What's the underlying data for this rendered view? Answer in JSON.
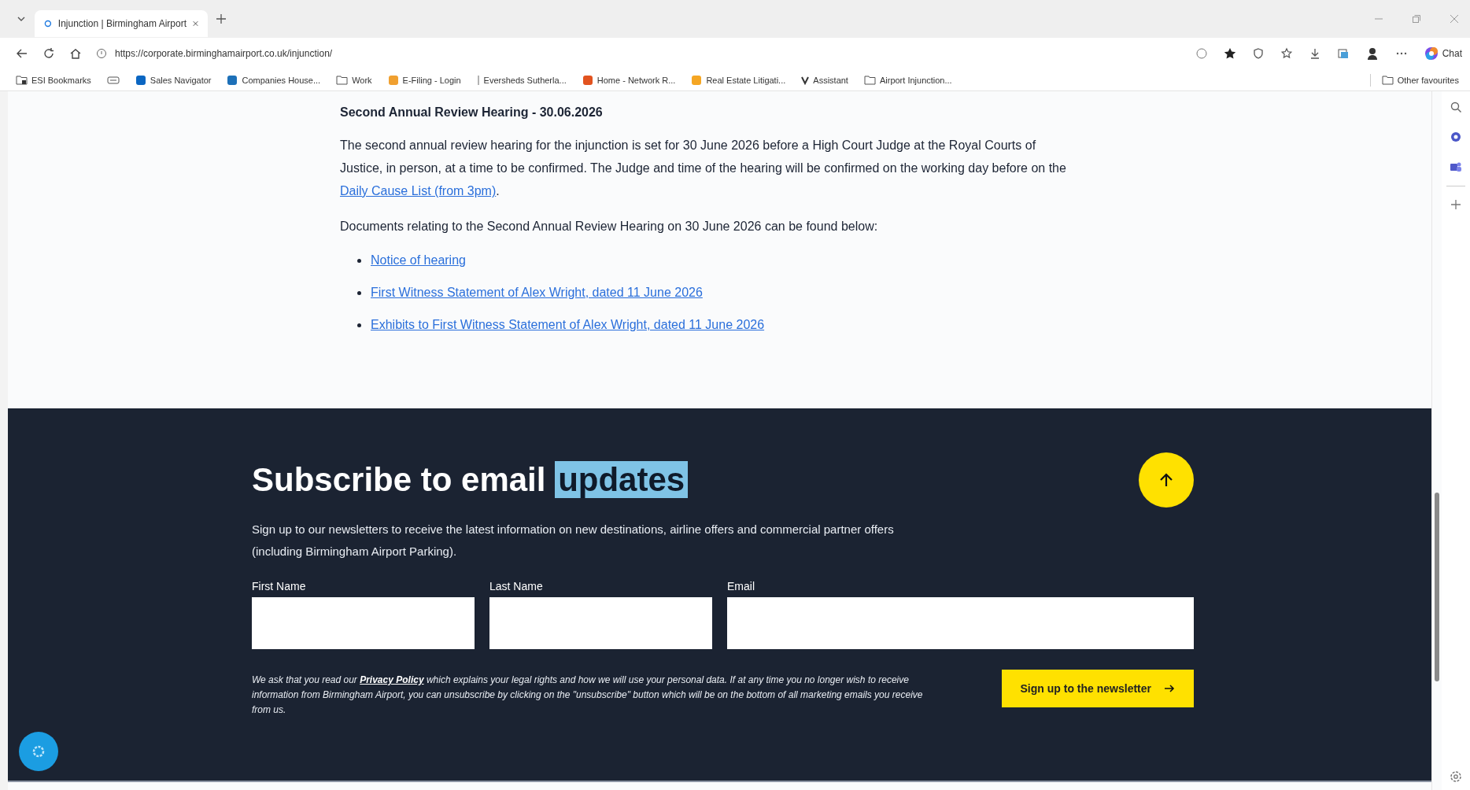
{
  "browser": {
    "tabs": [
      {
        "title": "Injunction | Birmingham Airport",
        "selected": true
      }
    ],
    "url": "https://corporate.birminghamairport.co.uk/injunction/",
    "chat_label": "Chat",
    "bookmarks": [
      {
        "kind": "folder-star",
        "label": "ESI Bookmarks"
      },
      {
        "kind": "card"
      },
      {
        "kind": "site",
        "label": "Sales Navigator",
        "color": "#0a66c2"
      },
      {
        "kind": "site",
        "label": "Companies House...",
        "color": "#1d70b8"
      },
      {
        "kind": "folder",
        "label": "Work"
      },
      {
        "kind": "site",
        "label": "E-Filing - Login",
        "color": "#f0a030"
      },
      {
        "kind": "bar",
        "label": "Eversheds Sutherla..."
      },
      {
        "kind": "site",
        "label": "Home - Network R...",
        "color": "#e2531f"
      },
      {
        "kind": "site",
        "label": "Real Estate Litigati...",
        "color": "#f5a623"
      },
      {
        "kind": "mark",
        "label": "Assistant"
      },
      {
        "kind": "folder",
        "label": "Airport Injunction..."
      }
    ],
    "other_bookmarks": "Other favourites"
  },
  "section": {
    "heading": "Second Annual Review Hearing - 30.06.2026",
    "paragraph": {
      "before": "The second annual review hearing for the injunction is set for 30 June 2026 before a High Court Judge at the Royal Courts of Justice, in person, at a time to be confirmed. The Judge and time of the hearing will be confirmed on the working day before on the ",
      "link": "Daily Cause List (from 3pm)",
      "after": "."
    },
    "intro": "Documents relating to the Second Annual Review Hearing on 30 June 2026 can be found below:",
    "documents": [
      "Notice of hearing",
      "First Witness Statement of Alex Wright, dated 11 June 2026",
      "Exhibits to First Witness Statement of Alex Wright, dated 11 June 2026"
    ]
  },
  "newsletter": {
    "heading": [
      {
        "text": "Subscribe to email ",
        "highlighted": false
      },
      {
        "text": "updates",
        "highlighted": true
      }
    ],
    "description": "Sign up to our newsletters to receive the latest information on new destinations, airline offers and commercial partner offers (including Birmingham Airport Parking).",
    "fields": [
      {
        "label": "First Name"
      },
      {
        "label": "Last Name"
      },
      {
        "label": "Email"
      }
    ],
    "privacy": {
      "before": "We ask that you read our ",
      "link": "Privacy Policy",
      "after": " which explains your legal rights and how we will use your personal data. If at any time you no longer wish to receive information from Birmingham Airport, you can unsubscribe by clicking on the \"unsubscribe\" button which will be on the bottom of all marketing emails you receive from us."
    },
    "button": "Sign up to the newsletter"
  }
}
